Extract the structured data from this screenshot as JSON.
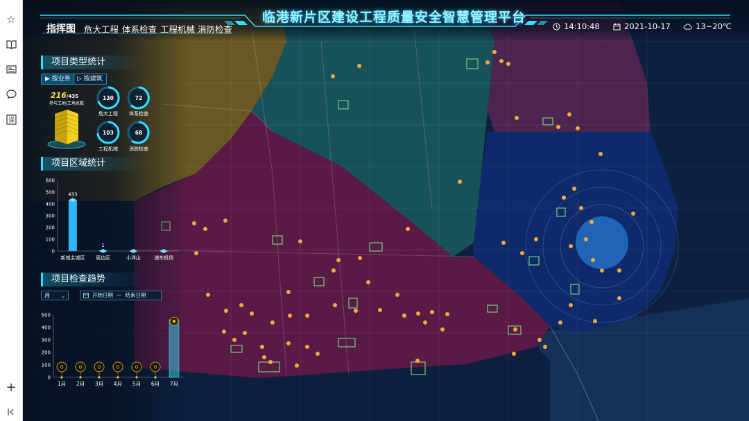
{
  "header": {
    "title": "临港新片区建设工程质量安全智慧管理平台",
    "nav": [
      "指挥图",
      "危大工程",
      "体系检查",
      "工程机械",
      "消防检查"
    ],
    "active_nav": "指挥图",
    "time": "14:10:48",
    "date": "2021-10-17",
    "weather": "13~20℃"
  },
  "sidebar": {
    "icons": [
      "star-icon",
      "book-icon",
      "card-icon",
      "chat-icon",
      "translate-icon",
      "plus-icon",
      "collapse-icon"
    ]
  },
  "project_type": {
    "title": "项目类型统计",
    "toggle": [
      "按业务",
      "按建筑"
    ],
    "total": "216",
    "total_of": "/435",
    "total_label": "参与工地/工地总数",
    "rings": [
      {
        "value": "130",
        "label": "危大工程"
      },
      {
        "value": "72",
        "label": "体系检查"
      },
      {
        "value": "103",
        "label": "工程机械"
      },
      {
        "value": "68",
        "label": "消防检查"
      }
    ]
  },
  "chart_data": [
    {
      "type": "bar",
      "title": "项目区域统计",
      "categories": [
        "新城主城区",
        "周边区",
        "小洋山",
        "浦东机场"
      ],
      "values": [
        433,
        1,
        0,
        0
      ],
      "data_labels": [
        "433",
        "1",
        "",
        ""
      ],
      "ylim": [
        0,
        600
      ],
      "yticks": [
        0,
        100,
        200,
        300,
        400,
        500,
        600
      ],
      "series": [
        {
          "name": "",
          "values": [
            433,
            1,
            0,
            0
          ]
        }
      ],
      "xlabel": "",
      "ylabel": ""
    },
    {
      "type": "bar",
      "title": "项目检查趋势",
      "categories": [
        "1月",
        "2月",
        "3月",
        "4月",
        "5月",
        "6月",
        "7月"
      ],
      "values": [
        0,
        0,
        0,
        0,
        0,
        0,
        460
      ],
      "data_labels": [
        "0",
        "0",
        "0",
        "0",
        "0",
        "0",
        ""
      ],
      "ylim": [
        0,
        500
      ],
      "yticks": [
        0,
        100,
        200,
        300,
        400,
        500
      ],
      "xlabel": "",
      "ylabel": ""
    }
  ],
  "trend_controls": {
    "period": "月",
    "start_placeholder": "开始日期",
    "separator": "—",
    "end_placeholder": "结束日期"
  },
  "colors": {
    "accent": "#2ee3ff",
    "zone_yellow": "#6d5a22",
    "zone_teal": "#17525a",
    "zone_purple": "#4a1b42",
    "zone_magenta": "#5a1a44",
    "zone_blue": "#0f2a66",
    "marker": "#f5a93a"
  }
}
